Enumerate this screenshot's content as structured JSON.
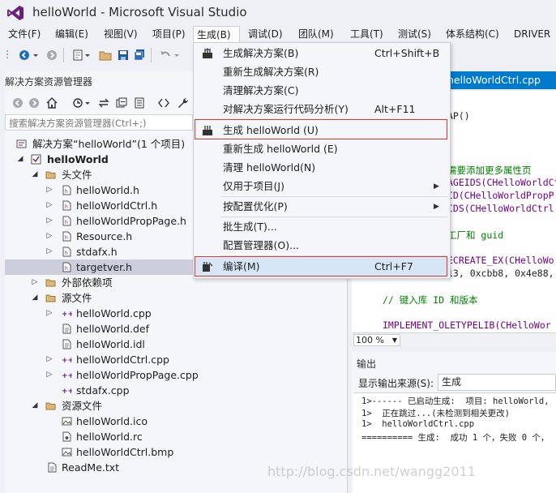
{
  "title": "helloWorld - Microsoft Visual Studio",
  "colors": {
    "accent": "#007acc",
    "brand": "#68217a",
    "highlight_border": "#e0332a"
  },
  "menubar": [
    {
      "label": "文件(F)"
    },
    {
      "label": "编辑(E)"
    },
    {
      "label": "视图(V)"
    },
    {
      "label": "项目(P)"
    },
    {
      "label": "生成(B)"
    },
    {
      "label": "调试(D)"
    },
    {
      "label": "团队(M)"
    },
    {
      "label": "工具(T)"
    },
    {
      "label": "测试(S)"
    },
    {
      "label": "体系结构(C)"
    },
    {
      "label": "DRIVER"
    }
  ],
  "build_menu": {
    "items": [
      {
        "label": "生成解决方案(B)",
        "shortcut": "Ctrl+Shift+B",
        "icon": "build-solution-icon"
      },
      {
        "label": "重新生成解决方案(R)",
        "shortcut": ""
      },
      {
        "label": "清理解决方案(C)",
        "shortcut": ""
      },
      {
        "label": "对解决方案运行代码分析(Y)",
        "shortcut": "Alt+F11"
      },
      {
        "label": "生成 helloWorld (U)",
        "shortcut": "",
        "icon": "build-project-icon"
      },
      {
        "label": "重新生成 helloWorld (E)",
        "shortcut": ""
      },
      {
        "label": "清理 helloWorld(N)",
        "shortcut": ""
      },
      {
        "label": "仅用于项目(J)",
        "shortcut": "",
        "submenu": true
      },
      {
        "label": "按配置优化(P)",
        "shortcut": "",
        "submenu": true
      },
      {
        "label": "批生成(T)...",
        "shortcut": ""
      },
      {
        "label": "配置管理器(O)...",
        "shortcut": ""
      },
      {
        "label": "编译(M)",
        "shortcut": "Ctrl+F7",
        "icon": "compile-icon"
      }
    ]
  },
  "solution_explorer": {
    "title": "解决方案资源管理器",
    "search_placeholder": "搜索解决方案资源管理器(Ctrl+;)",
    "tree": [
      {
        "label": "解决方案“helloWorld”(1 个项目)",
        "icon": "solution-icon"
      },
      {
        "label": "helloWorld",
        "icon": "project-icon"
      },
      {
        "label": "头文件",
        "icon": "folder-icon"
      },
      {
        "label": "helloWorld.h",
        "icon": "header-file-icon"
      },
      {
        "label": "helloWorldCtrl.h",
        "icon": "header-file-icon"
      },
      {
        "label": "helloWorldPropPage.h",
        "icon": "header-file-icon"
      },
      {
        "label": "Resource.h",
        "icon": "header-file-icon"
      },
      {
        "label": "stdafx.h",
        "icon": "header-file-icon"
      },
      {
        "label": "targetver.h",
        "icon": "header-file-icon",
        "selected": true
      },
      {
        "label": "外部依赖项",
        "icon": "folder-icon"
      },
      {
        "label": "源文件",
        "icon": "folder-icon"
      },
      {
        "label": "helloWorld.cpp",
        "icon": "cpp-file-icon"
      },
      {
        "label": "helloWorld.def",
        "icon": "file-icon"
      },
      {
        "label": "helloWorld.idl",
        "icon": "file-icon"
      },
      {
        "label": "helloWorldCtrl.cpp",
        "icon": "cpp-file-icon"
      },
      {
        "label": "helloWorldPropPage.cpp",
        "icon": "cpp-file-icon"
      },
      {
        "label": "stdafx.cpp",
        "icon": "cpp-file-icon"
      },
      {
        "label": "资源文件",
        "icon": "folder-icon"
      },
      {
        "label": "helloWorld.ico",
        "icon": "image-file-icon"
      },
      {
        "label": "helloWorld.rc",
        "icon": "rc-file-icon"
      },
      {
        "label": "helloWorldCtrl.bmp",
        "icon": "image-file-icon"
      },
      {
        "label": "ReadMe.txt",
        "icon": "text-file-icon"
      }
    ]
  },
  "editor": {
    "tab_label": "helloWorldCtrl.cpp",
    "zoom": "100 %",
    "lines": [
      "AP()",
      "需要添加更多属性页",
      "AGEIDS(CHelloWorldCt",
      "ID(CHelloWorldPropP",
      "IDS(CHelloWorldCtrl",
      "工厂和 guid",
      "ECREATE_EX(CHelloWo",
      "13, 0xcbb8, 0x4e88,",
      "// 键入库 ID 和版本",
      "IMPLEMENT_OLETYPELIB(CHelloWor"
    ]
  },
  "output": {
    "title": "输出",
    "source_label": "显示输出来源(S):",
    "source_value": "生成",
    "lines": [
      "1>------ 已启动生成:  项目: helloWorld,",
      "1>  正在跳过...(未检测到相关更改)",
      "1>  helloWorldCtrl.cpp",
      "========== 生成:  成功 1 个，失败 0 个，"
    ]
  },
  "watermark": "http://blog.csdn.net/wangg2011"
}
